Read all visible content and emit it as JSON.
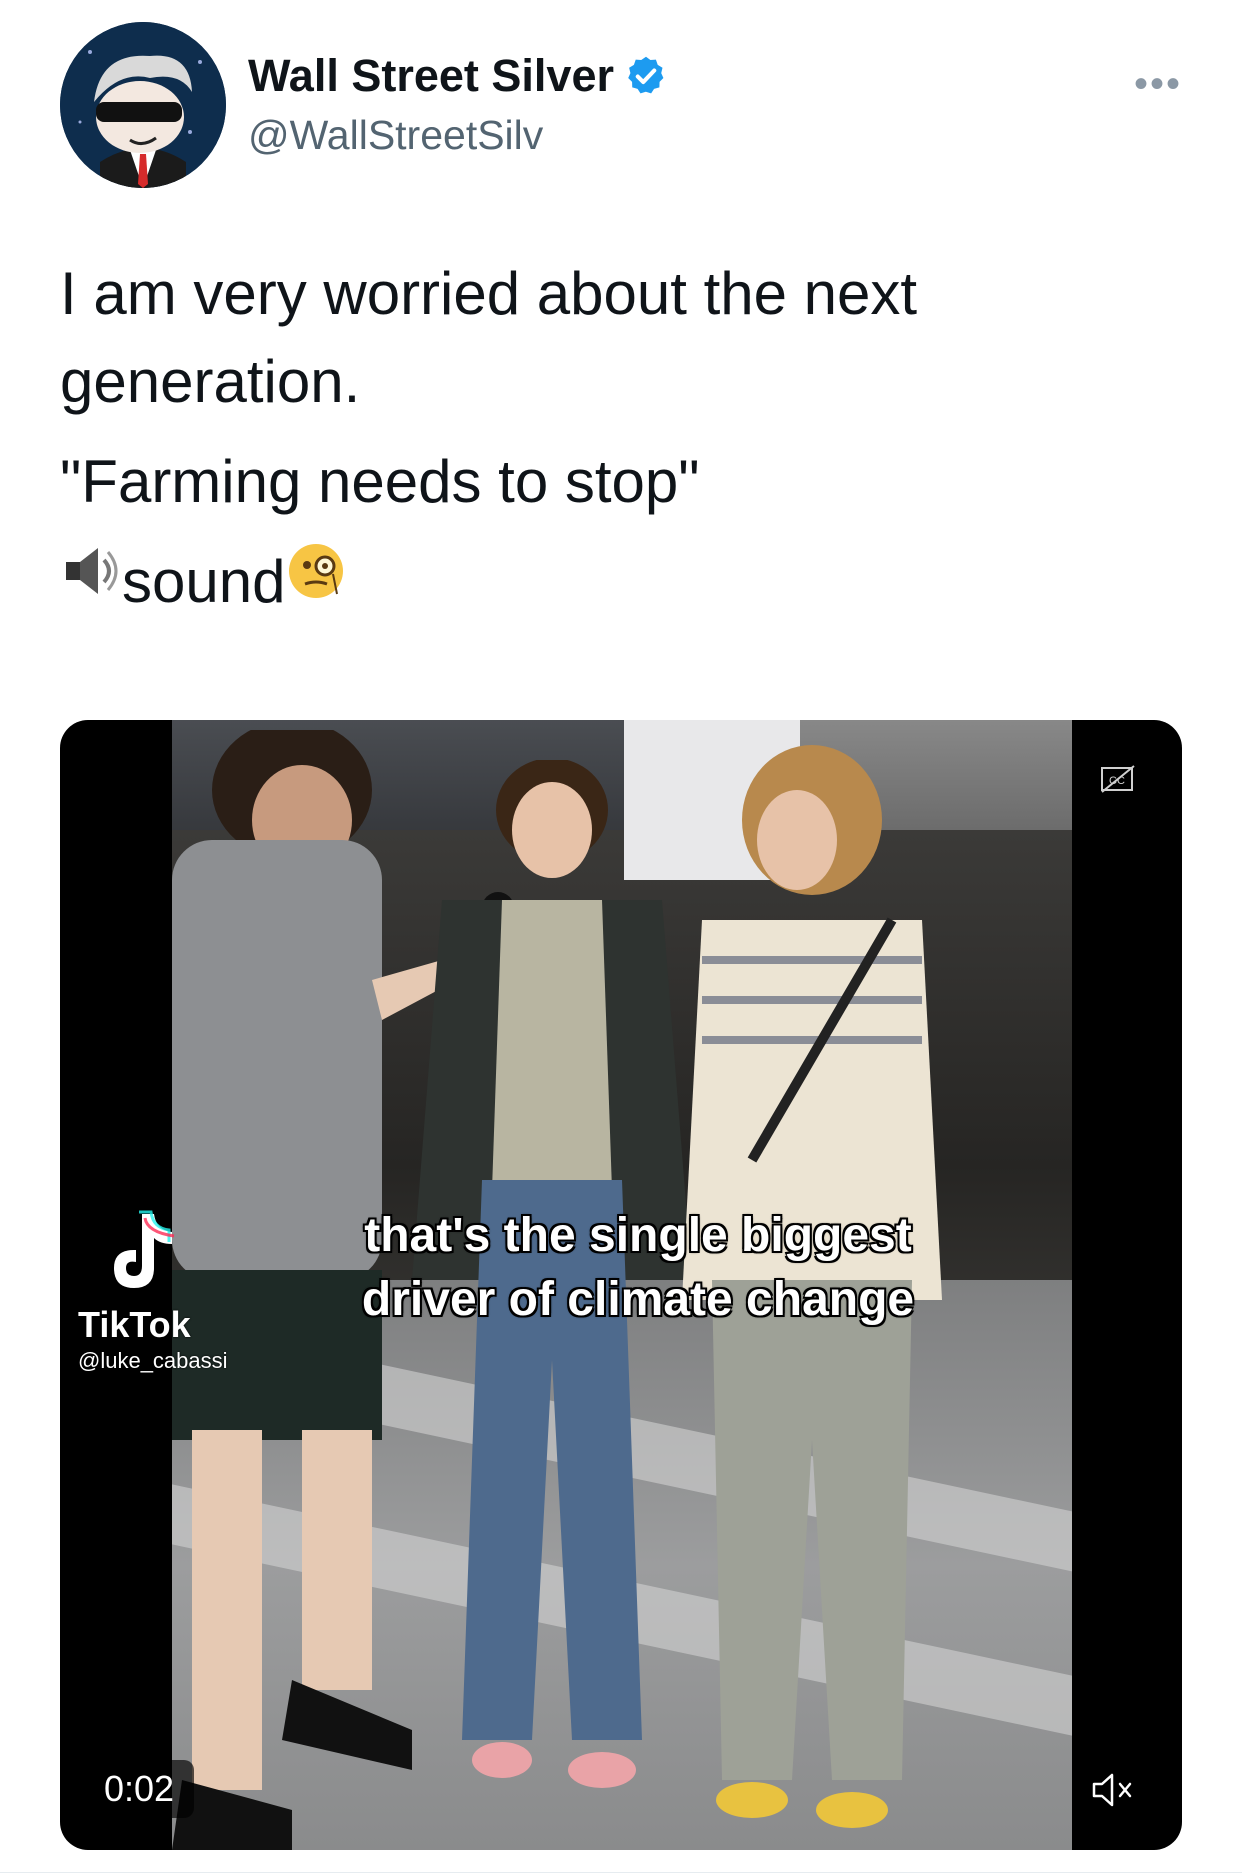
{
  "tweet": {
    "author_name": "Wall Street Silver",
    "handle": "@WallStreetSilv",
    "verified": true,
    "more_label": "•••",
    "text_line1": "I am very worried about the next generation.",
    "text_line2": "\"Farming needs to stop\"",
    "text_line3": "sound",
    "emoji_before": "speaker-icon",
    "emoji_after": "face-with-monocle-icon"
  },
  "video": {
    "caption_line1": "that's the single biggest",
    "caption_line2": "driver of climate change",
    "watermark_brand": "TikTok",
    "watermark_user": "@luke_cabassi",
    "elapsed_time": "0:02",
    "captions_button": "closed-captions-icon",
    "mute_button": "muted-speaker-icon"
  },
  "colors": {
    "verified_blue": "#1d9bf0",
    "handle_gray": "#536471",
    "text": "#0f1419"
  }
}
